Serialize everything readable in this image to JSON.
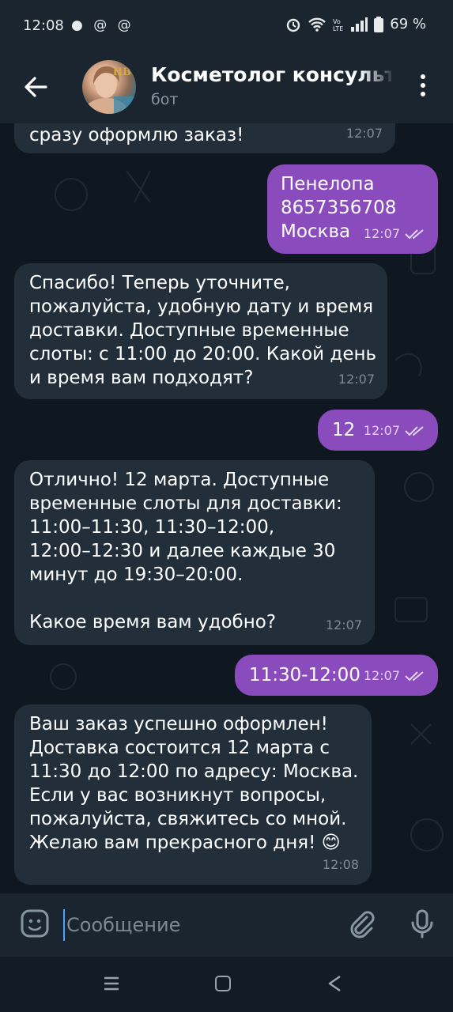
{
  "status_bar": {
    "time": "12:08",
    "left_icons": "● @ @",
    "battery": "69 %"
  },
  "header": {
    "title": "Косметолог консультант",
    "subtitle": "бот",
    "avatar_monogram": "HB"
  },
  "messages": [
    {
      "direction": "in",
      "text": "сразу оформлю заказ!",
      "time": "12:07"
    },
    {
      "direction": "out",
      "text": "Пенелопа\n8657356708\nМосква",
      "time": "12:07"
    },
    {
      "direction": "in",
      "text": "Спасибо! Теперь уточните,\nпожалуйста, удобную дату и время\nдоставки. Доступные временные\nслоты: с 11:00 до 20:00. Какой день\nи время вам подходят?",
      "time": "12:07"
    },
    {
      "direction": "out",
      "text": "12",
      "time": "12:07"
    },
    {
      "direction": "in",
      "text": "Отлично! 12 марта. Доступные\nвременные слоты для доставки:\n11:00–11:30, 11:30–12:00,\n12:00–12:30 и далее каждые 30\nминут до 19:30–20:00.\n\nКакое время вам удобно?",
      "time": "12:07"
    },
    {
      "direction": "out",
      "text": "11:30-12:00",
      "time": "12:07"
    },
    {
      "direction": "in",
      "text": "Ваш заказ успешно оформлен!\nДоставка состоится 12 марта с\n11:30 до 12:00 по адресу: Москва.\nЕсли у вас возникнут вопросы,\nпожалуйста, свяжитесь со мной.\nЖелаю вам прекрасного дня! 😊",
      "time": "12:08"
    }
  ],
  "input": {
    "placeholder": "Сообщение"
  },
  "colors": {
    "outgoing_bubble": "#8a4bbd",
    "incoming_bubble": "#222e3a",
    "header_bg": "#1b2530",
    "chat_bg": "#0f1820"
  }
}
